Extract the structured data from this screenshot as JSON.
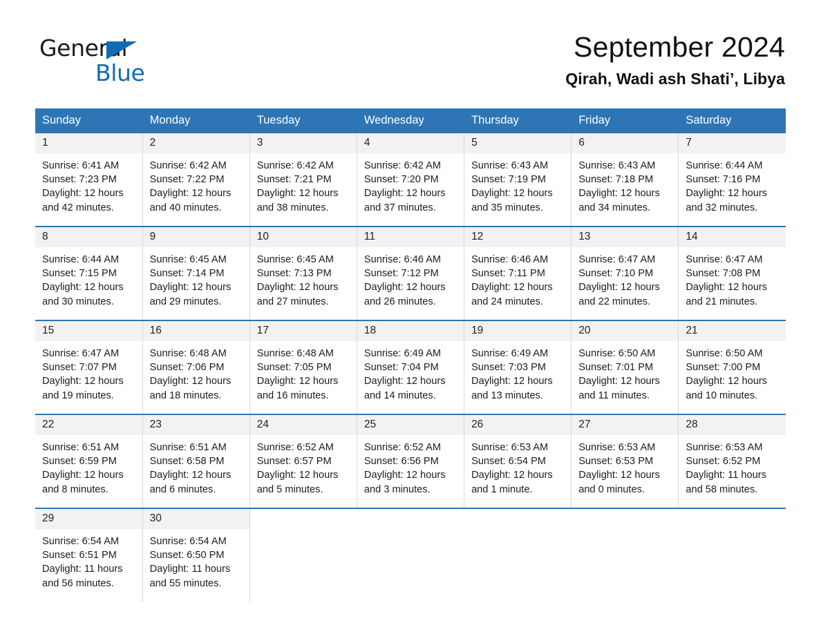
{
  "brand": {
    "name_dark": "General",
    "name_light": "Blue",
    "triangle_color": "#0f6cb5",
    "logo_icon": "triangle-flag-icon"
  },
  "header": {
    "title": "September 2024",
    "location": "Qirah, Wadi ash Shati’, Libya"
  },
  "theme": {
    "header_blue": "#2e75b6",
    "row_separator_blue": "#2e75b6",
    "daynum_band": "#f2f2f2",
    "column_divider": "#d8d8d8"
  },
  "calendar": {
    "weekday_headers": [
      "Sunday",
      "Monday",
      "Tuesday",
      "Wednesday",
      "Thursday",
      "Friday",
      "Saturday"
    ],
    "weeks": [
      [
        {
          "day": "1",
          "sunrise": "Sunrise: 6:41 AM",
          "sunset": "Sunset: 7:23 PM",
          "daylight_1": "Daylight: 12 hours",
          "daylight_2": "and 42 minutes."
        },
        {
          "day": "2",
          "sunrise": "Sunrise: 6:42 AM",
          "sunset": "Sunset: 7:22 PM",
          "daylight_1": "Daylight: 12 hours",
          "daylight_2": "and 40 minutes."
        },
        {
          "day": "3",
          "sunrise": "Sunrise: 6:42 AM",
          "sunset": "Sunset: 7:21 PM",
          "daylight_1": "Daylight: 12 hours",
          "daylight_2": "and 38 minutes."
        },
        {
          "day": "4",
          "sunrise": "Sunrise: 6:42 AM",
          "sunset": "Sunset: 7:20 PM",
          "daylight_1": "Daylight: 12 hours",
          "daylight_2": "and 37 minutes."
        },
        {
          "day": "5",
          "sunrise": "Sunrise: 6:43 AM",
          "sunset": "Sunset: 7:19 PM",
          "daylight_1": "Daylight: 12 hours",
          "daylight_2": "and 35 minutes."
        },
        {
          "day": "6",
          "sunrise": "Sunrise: 6:43 AM",
          "sunset": "Sunset: 7:18 PM",
          "daylight_1": "Daylight: 12 hours",
          "daylight_2": "and 34 minutes."
        },
        {
          "day": "7",
          "sunrise": "Sunrise: 6:44 AM",
          "sunset": "Sunset: 7:16 PM",
          "daylight_1": "Daylight: 12 hours",
          "daylight_2": "and 32 minutes."
        }
      ],
      [
        {
          "day": "8",
          "sunrise": "Sunrise: 6:44 AM",
          "sunset": "Sunset: 7:15 PM",
          "daylight_1": "Daylight: 12 hours",
          "daylight_2": "and 30 minutes."
        },
        {
          "day": "9",
          "sunrise": "Sunrise: 6:45 AM",
          "sunset": "Sunset: 7:14 PM",
          "daylight_1": "Daylight: 12 hours",
          "daylight_2": "and 29 minutes."
        },
        {
          "day": "10",
          "sunrise": "Sunrise: 6:45 AM",
          "sunset": "Sunset: 7:13 PM",
          "daylight_1": "Daylight: 12 hours",
          "daylight_2": "and 27 minutes."
        },
        {
          "day": "11",
          "sunrise": "Sunrise: 6:46 AM",
          "sunset": "Sunset: 7:12 PM",
          "daylight_1": "Daylight: 12 hours",
          "daylight_2": "and 26 minutes."
        },
        {
          "day": "12",
          "sunrise": "Sunrise: 6:46 AM",
          "sunset": "Sunset: 7:11 PM",
          "daylight_1": "Daylight: 12 hours",
          "daylight_2": "and 24 minutes."
        },
        {
          "day": "13",
          "sunrise": "Sunrise: 6:47 AM",
          "sunset": "Sunset: 7:10 PM",
          "daylight_1": "Daylight: 12 hours",
          "daylight_2": "and 22 minutes."
        },
        {
          "day": "14",
          "sunrise": "Sunrise: 6:47 AM",
          "sunset": "Sunset: 7:08 PM",
          "daylight_1": "Daylight: 12 hours",
          "daylight_2": "and 21 minutes."
        }
      ],
      [
        {
          "day": "15",
          "sunrise": "Sunrise: 6:47 AM",
          "sunset": "Sunset: 7:07 PM",
          "daylight_1": "Daylight: 12 hours",
          "daylight_2": "and 19 minutes."
        },
        {
          "day": "16",
          "sunrise": "Sunrise: 6:48 AM",
          "sunset": "Sunset: 7:06 PM",
          "daylight_1": "Daylight: 12 hours",
          "daylight_2": "and 18 minutes."
        },
        {
          "day": "17",
          "sunrise": "Sunrise: 6:48 AM",
          "sunset": "Sunset: 7:05 PM",
          "daylight_1": "Daylight: 12 hours",
          "daylight_2": "and 16 minutes."
        },
        {
          "day": "18",
          "sunrise": "Sunrise: 6:49 AM",
          "sunset": "Sunset: 7:04 PM",
          "daylight_1": "Daylight: 12 hours",
          "daylight_2": "and 14 minutes."
        },
        {
          "day": "19",
          "sunrise": "Sunrise: 6:49 AM",
          "sunset": "Sunset: 7:03 PM",
          "daylight_1": "Daylight: 12 hours",
          "daylight_2": "and 13 minutes."
        },
        {
          "day": "20",
          "sunrise": "Sunrise: 6:50 AM",
          "sunset": "Sunset: 7:01 PM",
          "daylight_1": "Daylight: 12 hours",
          "daylight_2": "and 11 minutes."
        },
        {
          "day": "21",
          "sunrise": "Sunrise: 6:50 AM",
          "sunset": "Sunset: 7:00 PM",
          "daylight_1": "Daylight: 12 hours",
          "daylight_2": "and 10 minutes."
        }
      ],
      [
        {
          "day": "22",
          "sunrise": "Sunrise: 6:51 AM",
          "sunset": "Sunset: 6:59 PM",
          "daylight_1": "Daylight: 12 hours",
          "daylight_2": "and 8 minutes."
        },
        {
          "day": "23",
          "sunrise": "Sunrise: 6:51 AM",
          "sunset": "Sunset: 6:58 PM",
          "daylight_1": "Daylight: 12 hours",
          "daylight_2": "and 6 minutes."
        },
        {
          "day": "24",
          "sunrise": "Sunrise: 6:52 AM",
          "sunset": "Sunset: 6:57 PM",
          "daylight_1": "Daylight: 12 hours",
          "daylight_2": "and 5 minutes."
        },
        {
          "day": "25",
          "sunrise": "Sunrise: 6:52 AM",
          "sunset": "Sunset: 6:56 PM",
          "daylight_1": "Daylight: 12 hours",
          "daylight_2": "and 3 minutes."
        },
        {
          "day": "26",
          "sunrise": "Sunrise: 6:53 AM",
          "sunset": "Sunset: 6:54 PM",
          "daylight_1": "Daylight: 12 hours",
          "daylight_2": "and 1 minute."
        },
        {
          "day": "27",
          "sunrise": "Sunrise: 6:53 AM",
          "sunset": "Sunset: 6:53 PM",
          "daylight_1": "Daylight: 12 hours",
          "daylight_2": "and 0 minutes."
        },
        {
          "day": "28",
          "sunrise": "Sunrise: 6:53 AM",
          "sunset": "Sunset: 6:52 PM",
          "daylight_1": "Daylight: 11 hours",
          "daylight_2": "and 58 minutes."
        }
      ],
      [
        {
          "day": "29",
          "sunrise": "Sunrise: 6:54 AM",
          "sunset": "Sunset: 6:51 PM",
          "daylight_1": "Daylight: 11 hours",
          "daylight_2": "and 56 minutes."
        },
        {
          "day": "30",
          "sunrise": "Sunrise: 6:54 AM",
          "sunset": "Sunset: 6:50 PM",
          "daylight_1": "Daylight: 11 hours",
          "daylight_2": "and 55 minutes."
        },
        {
          "day": "",
          "sunrise": "",
          "sunset": "",
          "daylight_1": "",
          "daylight_2": ""
        },
        {
          "day": "",
          "sunrise": "",
          "sunset": "",
          "daylight_1": "",
          "daylight_2": ""
        },
        {
          "day": "",
          "sunrise": "",
          "sunset": "",
          "daylight_1": "",
          "daylight_2": ""
        },
        {
          "day": "",
          "sunrise": "",
          "sunset": "",
          "daylight_1": "",
          "daylight_2": ""
        },
        {
          "day": "",
          "sunrise": "",
          "sunset": "",
          "daylight_1": "",
          "daylight_2": ""
        }
      ]
    ]
  }
}
